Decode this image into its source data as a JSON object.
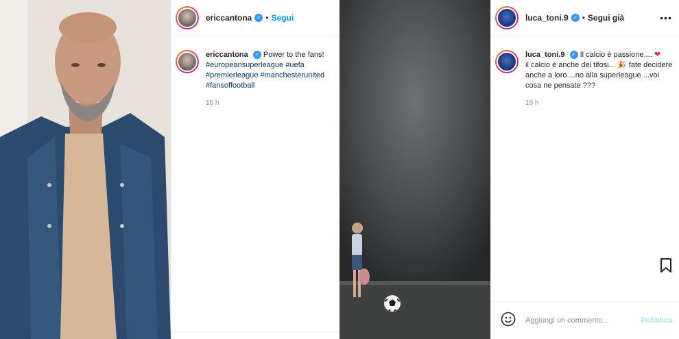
{
  "left_post": {
    "username": "ericcantona",
    "follow_label": "Segui",
    "dot": "•",
    "caption_text": "Power to the fans!",
    "hashtags": [
      "#europeansuperleague",
      "#uefa",
      "#premierleague",
      "#manchesterunited",
      "#fansoffootball"
    ],
    "time": "15 h"
  },
  "right_post": {
    "username": "luca_toni.9",
    "follow_label": "Segui già",
    "dot": "•",
    "more": "•••",
    "caption_line1": "Il calcio è passione....",
    "caption_line2": "il calcio è anche dei tifosi...",
    "caption_line3": "fate decidere anche a loro....no alla superleague ...voi cosa ne pensate ???",
    "time": "19 h",
    "comment_placeholder": "Aggiungi un commento...",
    "publish_label": "Pubblica"
  },
  "colors": {
    "accent": "#0095f6",
    "verified": "#3897f0",
    "muted": "#8e8e8e",
    "hashtag": "#00376b"
  },
  "icons": [
    "verified-badge-icon",
    "more-options-icon",
    "save-bookmark-icon",
    "emoji-icon",
    "heart-emoji-icon",
    "party-emoji-icon"
  ]
}
